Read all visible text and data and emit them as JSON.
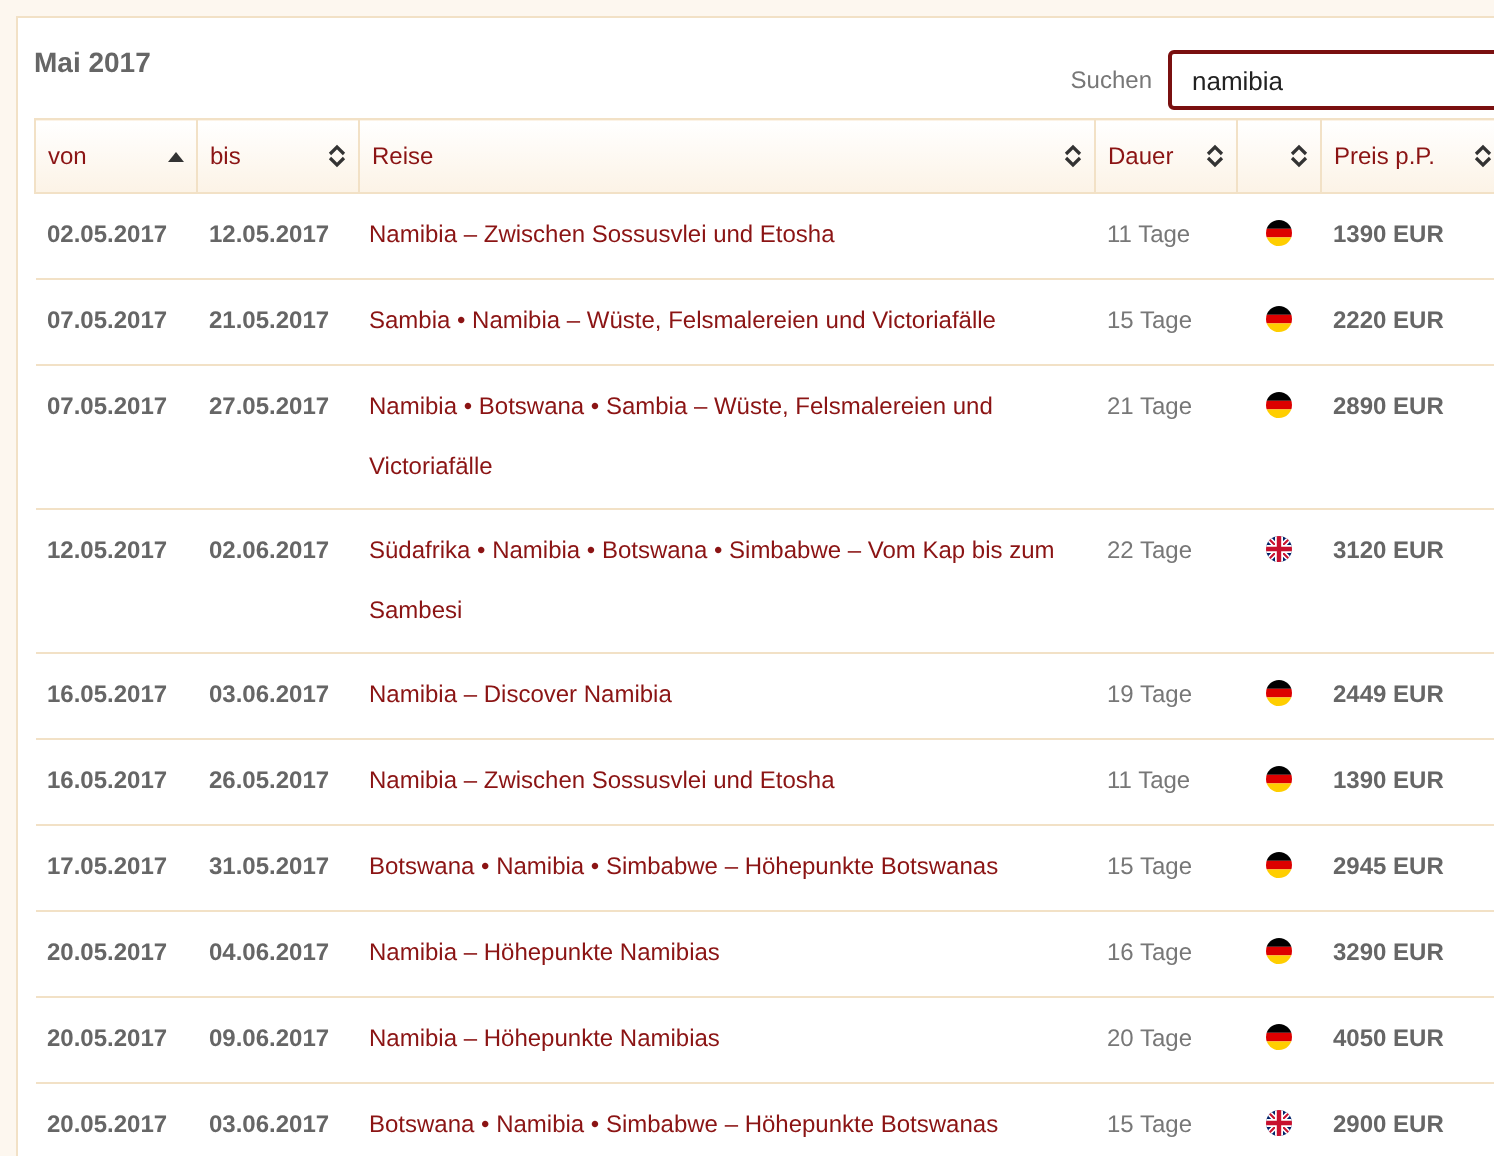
{
  "title": "Mai 2017",
  "search": {
    "label": "Suchen",
    "value": "namibia"
  },
  "columns": [
    {
      "label": "von",
      "sorted": true
    },
    {
      "label": "bis",
      "sorted": false
    },
    {
      "label": "Reise",
      "sorted": false
    },
    {
      "label": "Dauer",
      "sorted": false
    },
    {
      "sorted": false
    },
    {
      "label": "Preis p.P.",
      "sorted": false
    }
  ],
  "rows": [
    {
      "von": "02.05.2017",
      "bis": "12.05.2017",
      "reise": "Namibia – Zwischen Sossusvlei und Etosha",
      "dauer": "11 Tage",
      "kind": "de",
      "preis": "1390 EUR"
    },
    {
      "von": "07.05.2017",
      "bis": "21.05.2017",
      "reise": "Sambia • Namibia – Wüste, Felsmalereien und Victoriafälle",
      "dauer": "15 Tage",
      "kind": "de",
      "preis": "2220 EUR"
    },
    {
      "von": "07.05.2017",
      "bis": "27.05.2017",
      "reise": "Namibia • Botswana • Sambia – Wüste, Felsmalereien und Victoriafälle",
      "dauer": "21 Tage",
      "kind": "de",
      "preis": "2890 EUR"
    },
    {
      "von": "12.05.2017",
      "bis": "02.06.2017",
      "reise": "Südafrika • Namibia • Botswana • Simbabwe – Vom Kap bis zum Sambesi",
      "dauer": "22 Tage",
      "kind": "gb",
      "preis": "3120 EUR"
    },
    {
      "von": "16.05.2017",
      "bis": "03.06.2017",
      "reise": "Namibia – Discover Namibia",
      "dauer": "19 Tage",
      "kind": "de",
      "preis": "2449 EUR"
    },
    {
      "von": "16.05.2017",
      "bis": "26.05.2017",
      "reise": "Namibia – Zwischen Sossusvlei und Etosha",
      "dauer": "11 Tage",
      "kind": "de",
      "preis": "1390 EUR"
    },
    {
      "von": "17.05.2017",
      "bis": "31.05.2017",
      "reise": "Botswana • Namibia • Simbabwe – Höhepunkte Botswanas",
      "dauer": "15 Tage",
      "kind": "de",
      "preis": "2945 EUR"
    },
    {
      "von": "20.05.2017",
      "bis": "04.06.2017",
      "reise": "Namibia – Höhepunkte Namibias",
      "dauer": "16 Tage",
      "kind": "de",
      "preis": "3290 EUR"
    },
    {
      "von": "20.05.2017",
      "bis": "09.06.2017",
      "reise": "Namibia – Höhepunkte Namibias",
      "dauer": "20 Tage",
      "kind": "de",
      "preis": "4050 EUR"
    },
    {
      "von": "20.05.2017",
      "bis": "03.06.2017",
      "reise": "Botswana • Namibia • Simbabwe – Höhepunkte Botswanas",
      "dauer": "15 Tage",
      "kind": "gb",
      "preis": "2900 EUR"
    }
  ]
}
